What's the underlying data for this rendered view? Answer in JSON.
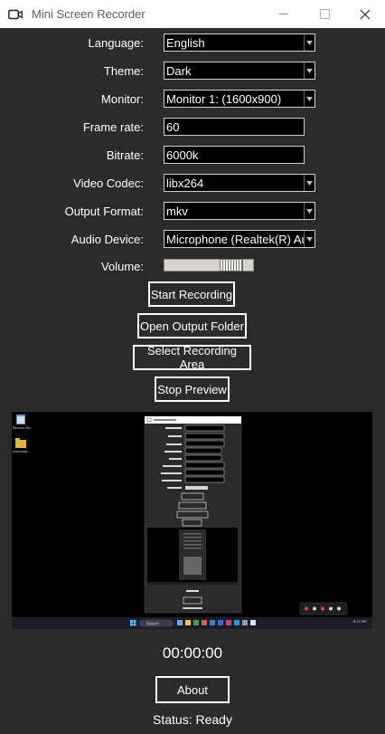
{
  "window": {
    "title": "Mini Screen Recorder",
    "controls": {
      "minimize": "—",
      "maximize": "☐",
      "close": "✕"
    }
  },
  "settings": {
    "language": {
      "label": "Language:",
      "value": "English"
    },
    "theme": {
      "label": "Theme:",
      "value": "Dark"
    },
    "monitor": {
      "label": "Monitor:",
      "value": "Monitor 1: (1600x900)"
    },
    "frame_rate": {
      "label": "Frame rate:",
      "value": "60"
    },
    "bitrate": {
      "label": "Bitrate:",
      "value": "6000k"
    },
    "video_codec": {
      "label": "Video Codec:",
      "value": "libx264"
    },
    "output_format": {
      "label": "Output Format:",
      "value": "mkv"
    },
    "audio_device": {
      "label": "Audio Device:",
      "value": "Microphone (Realtek(R) Audio)"
    },
    "volume": {
      "label": "Volume:",
      "level": 0.85
    }
  },
  "buttons": {
    "start_recording": "Start Recording",
    "open_output_folder": "Open Output Folder",
    "select_recording_area": "Select Recording Area",
    "stop_preview": "Stop Preview",
    "about": "About"
  },
  "preview": {
    "desktop_icons": [
      "Recycle Bin",
      "ashmeda..."
    ],
    "taskbar_search": "Search",
    "clock": "6:12 PM"
  },
  "timer": "00:00:00",
  "status": "Status: Ready",
  "colors": {
    "background": "#2b2b2b",
    "field_background": "#000000",
    "text": "#ffffff",
    "titlebar": "#ffffff"
  }
}
